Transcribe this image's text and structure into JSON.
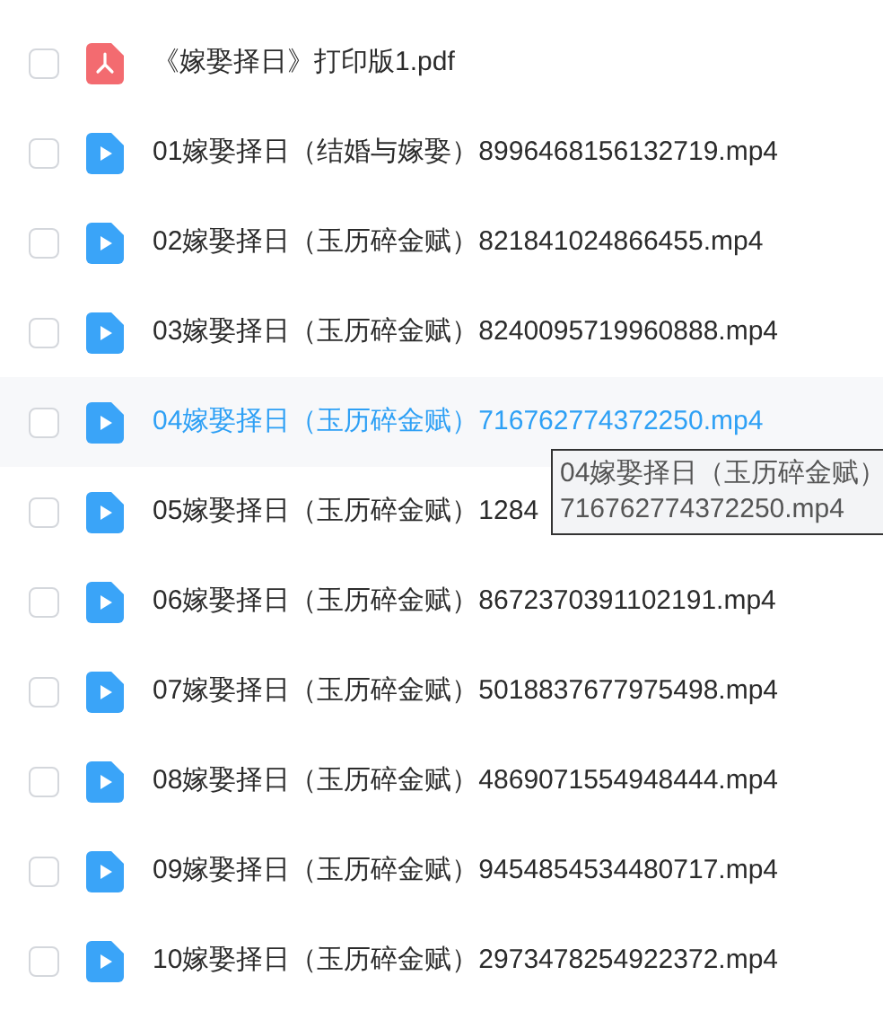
{
  "files": [
    {
      "kind": "pdf",
      "name": "《嫁娶择日》打印版1.pdf",
      "checked": false,
      "hovered": false
    },
    {
      "kind": "video",
      "name": "01嫁娶择日（结婚与嫁娶）8996468156132719.mp4",
      "checked": false,
      "hovered": false
    },
    {
      "kind": "video",
      "name": "02嫁娶择日（玉历碎金赋）821841024866455.mp4",
      "checked": false,
      "hovered": false
    },
    {
      "kind": "video",
      "name": "03嫁娶择日（玉历碎金赋）8240095719960888.mp4",
      "checked": false,
      "hovered": false
    },
    {
      "kind": "video",
      "name": "04嫁娶择日（玉历碎金赋）716762774372250.mp4",
      "checked": false,
      "hovered": true
    },
    {
      "kind": "video",
      "name": "05嫁娶择日（玉历碎金赋）1284",
      "checked": false,
      "hovered": false
    },
    {
      "kind": "video",
      "name": "06嫁娶择日（玉历碎金赋）8672370391102191.mp4",
      "checked": false,
      "hovered": false
    },
    {
      "kind": "video",
      "name": "07嫁娶择日（玉历碎金赋）5018837677975498.mp4",
      "checked": false,
      "hovered": false
    },
    {
      "kind": "video",
      "name": "08嫁娶择日（玉历碎金赋）4869071554948444.mp4",
      "checked": false,
      "hovered": false
    },
    {
      "kind": "video",
      "name": "09嫁娶择日（玉历碎金赋）9454854534480717.mp4",
      "checked": false,
      "hovered": false
    },
    {
      "kind": "video",
      "name": "10嫁娶择日（玉历碎金赋）2973478254922372.mp4",
      "checked": false,
      "hovered": false
    }
  ],
  "tooltip": {
    "lines": [
      "04嫁娶择日（玉历碎金赋）",
      "716762774372250.mp4"
    ]
  }
}
